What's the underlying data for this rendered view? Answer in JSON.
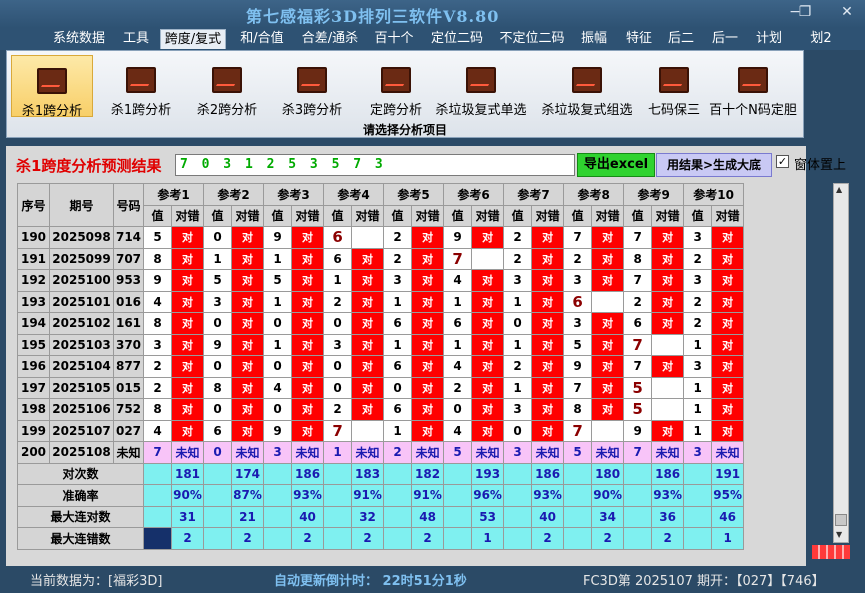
{
  "window": {
    "title": "第七感福彩3D排列三软件V8.80",
    "minimize": "−",
    "restore": "❐",
    "close": "✕"
  },
  "menu": [
    "系统数据",
    "工具",
    "跨度/复式",
    "和/合值",
    "合差/通杀",
    "百十个",
    "定位二码",
    "不定位二码",
    "振幅",
    "特征",
    "后二",
    "后一",
    "计划",
    "划2"
  ],
  "menu_active": 2,
  "ribbon": {
    "buttons": [
      "杀1跨分析",
      "杀1跨分析",
      "杀2跨分析",
      "杀3跨分析",
      "定跨分析",
      "杀垃圾复式单选",
      "杀垃圾复式组选",
      "七码保三",
      "百十个N码定胆"
    ],
    "group_label": "请选择分析项目"
  },
  "result": {
    "label": "杀1跨度分析预测结果",
    "value": "7 0 3 1 2 5 3 5 7 3",
    "export_button": "导出excel",
    "generate_button": "用结果>生成大底",
    "checkbox_label": "窗体置上",
    "checkbox_checked": "✓"
  },
  "table": {
    "headers": {
      "seq": "序号",
      "period": "期号",
      "code": "号码",
      "value": "值",
      "correct": "对错",
      "refs": [
        "参考1",
        "参考2",
        "参考3",
        "参考4",
        "参考5",
        "参考6",
        "参考7",
        "参考8",
        "参考9",
        "参考10"
      ]
    },
    "rows": [
      {
        "seq": "190",
        "period": "2025098",
        "code": "714",
        "vals": [
          "5",
          "0",
          "9",
          "6",
          "2",
          "9",
          "2",
          "7",
          "7",
          "3"
        ],
        "marks": [
          "对",
          "对",
          "对",
          "",
          "对",
          "对",
          "对",
          "对",
          "对",
          "对"
        ]
      },
      {
        "seq": "191",
        "period": "2025099",
        "code": "707",
        "vals": [
          "8",
          "1",
          "1",
          "6",
          "2",
          "7",
          "2",
          "2",
          "8",
          "2"
        ],
        "marks": [
          "对",
          "对",
          "对",
          "对",
          "对",
          "",
          "对",
          "对",
          "对",
          "对"
        ]
      },
      {
        "seq": "192",
        "period": "2025100",
        "code": "953",
        "vals": [
          "9",
          "5",
          "5",
          "1",
          "3",
          "4",
          "3",
          "3",
          "7",
          "3"
        ],
        "marks": [
          "对",
          "对",
          "对",
          "对",
          "对",
          "对",
          "对",
          "对",
          "对",
          "对"
        ]
      },
      {
        "seq": "193",
        "period": "2025101",
        "code": "016",
        "vals": [
          "4",
          "3",
          "1",
          "2",
          "1",
          "1",
          "1",
          "6",
          "2",
          "2"
        ],
        "marks": [
          "对",
          "对",
          "对",
          "对",
          "对",
          "对",
          "对",
          "",
          "对",
          "对"
        ]
      },
      {
        "seq": "194",
        "period": "2025102",
        "code": "161",
        "vals": [
          "8",
          "0",
          "0",
          "0",
          "6",
          "6",
          "0",
          "3",
          "6",
          "2"
        ],
        "marks": [
          "对",
          "对",
          "对",
          "对",
          "对",
          "对",
          "对",
          "对",
          "对",
          "对"
        ]
      },
      {
        "seq": "195",
        "period": "2025103",
        "code": "370",
        "vals": [
          "3",
          "9",
          "1",
          "3",
          "1",
          "1",
          "1",
          "5",
          "7",
          "1"
        ],
        "marks": [
          "对",
          "对",
          "对",
          "对",
          "对",
          "对",
          "对",
          "对",
          "",
          "对"
        ]
      },
      {
        "seq": "196",
        "period": "2025104",
        "code": "877",
        "vals": [
          "2",
          "0",
          "0",
          "0",
          "6",
          "4",
          "2",
          "9",
          "7",
          "3"
        ],
        "marks": [
          "对",
          "对",
          "对",
          "对",
          "对",
          "对",
          "对",
          "对",
          "对",
          "对"
        ]
      },
      {
        "seq": "197",
        "period": "2025105",
        "code": "015",
        "vals": [
          "2",
          "8",
          "4",
          "0",
          "0",
          "2",
          "1",
          "7",
          "5",
          "1"
        ],
        "marks": [
          "对",
          "对",
          "对",
          "对",
          "对",
          "对",
          "对",
          "对",
          "",
          "对"
        ]
      },
      {
        "seq": "198",
        "period": "2025106",
        "code": "752",
        "vals": [
          "8",
          "0",
          "0",
          "2",
          "6",
          "0",
          "3",
          "8",
          "5",
          "1"
        ],
        "marks": [
          "对",
          "对",
          "对",
          "对",
          "对",
          "对",
          "对",
          "对",
          "",
          "对"
        ]
      },
      {
        "seq": "199",
        "period": "2025107",
        "code": "027",
        "vals": [
          "4",
          "6",
          "9",
          "7",
          "1",
          "4",
          "0",
          "7",
          "9",
          "1"
        ],
        "marks": [
          "对",
          "对",
          "对",
          "",
          "对",
          "对",
          "对",
          "",
          "对",
          "对"
        ]
      }
    ],
    "big_cells": [
      [
        0,
        3
      ],
      [
        1,
        5
      ],
      [
        3,
        7
      ],
      [
        5,
        8
      ],
      [
        7,
        8
      ],
      [
        8,
        8
      ],
      [
        9,
        3
      ],
      [
        9,
        7
      ]
    ],
    "waiting_row": {
      "seq": "200",
      "period": "2025108",
      "code": "未知",
      "vals": [
        "7",
        "0",
        "3",
        "1",
        "2",
        "5",
        "3",
        "5",
        "7",
        "3"
      ],
      "status": "未知"
    },
    "stats": [
      {
        "label": "对次数",
        "values": [
          "181",
          "174",
          "186",
          "183",
          "182",
          "193",
          "186",
          "180",
          "186",
          "191"
        ]
      },
      {
        "label": "准确率",
        "values": [
          "90%",
          "87%",
          "93%",
          "91%",
          "91%",
          "96%",
          "93%",
          "90%",
          "93%",
          "95%"
        ]
      },
      {
        "label": "最大连对数",
        "values": [
          "31",
          "21",
          "40",
          "32",
          "48",
          "53",
          "40",
          "34",
          "36",
          "46"
        ]
      },
      {
        "label": "最大连错数",
        "values": [
          "2",
          "2",
          "2",
          "2",
          "2",
          "1",
          "2",
          "2",
          "2",
          "1"
        ]
      }
    ]
  },
  "status": {
    "current_data": "当前数据为：[福彩3D]",
    "countdown": "自动更新倒计时：  22时51分1秒",
    "draw": "FC3D第 2025107 期开：【027】【746】"
  }
}
